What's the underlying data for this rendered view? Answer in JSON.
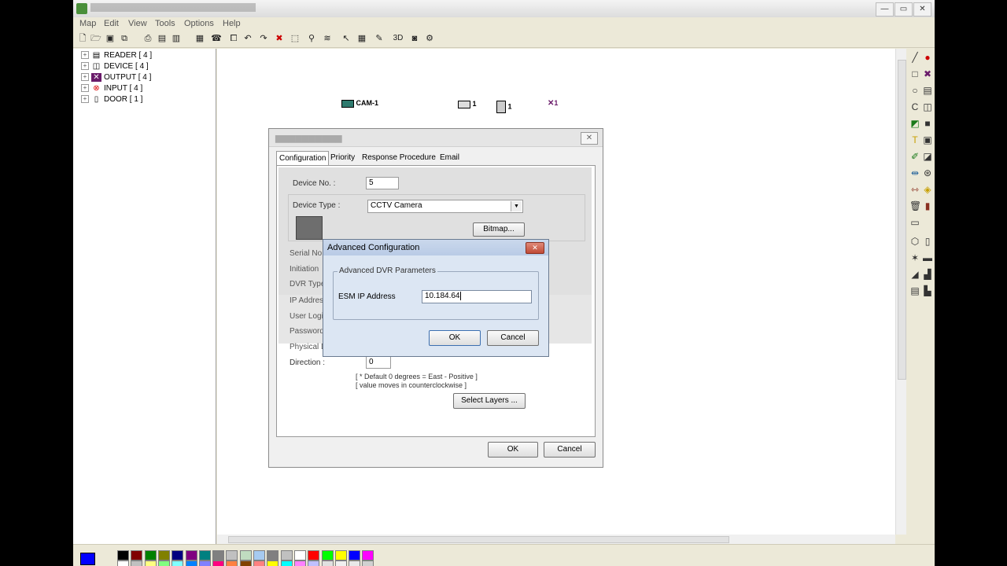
{
  "window": {
    "min_glyph": "—",
    "max_glyph": "▭",
    "close_glyph": "✕"
  },
  "menu": [
    "Map",
    "Edit",
    "View",
    "Tools",
    "Options",
    "Help"
  ],
  "toolbar_icons": [
    "new-icon",
    "open-icon",
    "save-icon",
    "copy-icon",
    "print-icon",
    "import-icon",
    "export-icon",
    "properties-icon",
    "phone-icon",
    "link-icon",
    "undo-icon",
    "redo-icon",
    "delete-icon",
    "select-icon",
    "find-icon",
    "layers-icon",
    "pointer-icon",
    "grid-icon",
    "zoom-icon",
    "3d-icon",
    "camera-view-icon",
    "settings-icon"
  ],
  "toolbar_3d_label": "3D",
  "tree": [
    {
      "label": "READER [ 4 ]",
      "icon": "reader-icon"
    },
    {
      "label": "DEVICE [ 4 ]",
      "icon": "device-icon"
    },
    {
      "label": "OUTPUT [ 4 ]",
      "icon": "output-icon"
    },
    {
      "label": "INPUT [ 4 ]",
      "icon": "input-icon"
    },
    {
      "label": "DOOR [ 1 ]",
      "icon": "door-icon"
    }
  ],
  "canvas": {
    "cam_label": "CAM-1",
    "reader_label": "1",
    "door_label": "1",
    "output_label": "1"
  },
  "device_dialog": {
    "tabs": [
      "Configuration",
      "Priority",
      "Response Procedure",
      "Email"
    ],
    "active_tab": "Configuration",
    "device_no_label": "Device No. :",
    "device_no_value": "5",
    "device_type_label": "Device Type :",
    "device_type_value": "CCTV Camera",
    "bitmap_button": "Bitmap...",
    "hidden_labels": [
      "Serial No.",
      "Initiation",
      "DVR Type",
      "IP Address",
      "User Login",
      "Password",
      "Physical D"
    ],
    "direction_label": "Direction :",
    "direction_value": "0",
    "note_line1": "[ * Default 0 degrees = East - Positive ]",
    "note_line2": "[ value moves in counterclockwise ]",
    "select_layers_button": "Select Layers ...",
    "ok_button": "OK",
    "cancel_button": "Cancel"
  },
  "advanced_dialog": {
    "title": "Advanced Configuration",
    "close_glyph": "✕",
    "group_title": "Advanced DVR Parameters",
    "esm_ip_label": "ESM IP Address",
    "esm_ip_value": "10.184.64",
    "ok_button": "OK",
    "cancel_button": "Cancel"
  },
  "palette_colors": [
    "#000000",
    "#800000",
    "#008000",
    "#808000",
    "#000080",
    "#800080",
    "#008080",
    "#808080",
    "#c0c0c0",
    "#c0dcc0",
    "#a6caf0",
    "#808080",
    "#c0c0c0",
    "#ffffff",
    "#ff0000",
    "#00ff00",
    "#ffff00",
    "#0000ff",
    "#ff00ff"
  ],
  "palette_colors_row2": [
    "#ffffff",
    "#c0c0c0",
    "#ffff80",
    "#80ff80",
    "#80ffff",
    "#0080ff",
    "#8080ff",
    "#ff0080",
    "#ff8040",
    "#804000",
    "#ff8080",
    "#ffff00",
    "#00ffff",
    "#ff80ff",
    "#c0c0ff",
    "#e0e0e0",
    "#f0f0f0",
    "#e8e8e8",
    "#d0d0d0"
  ],
  "current_color": "#0000ff"
}
